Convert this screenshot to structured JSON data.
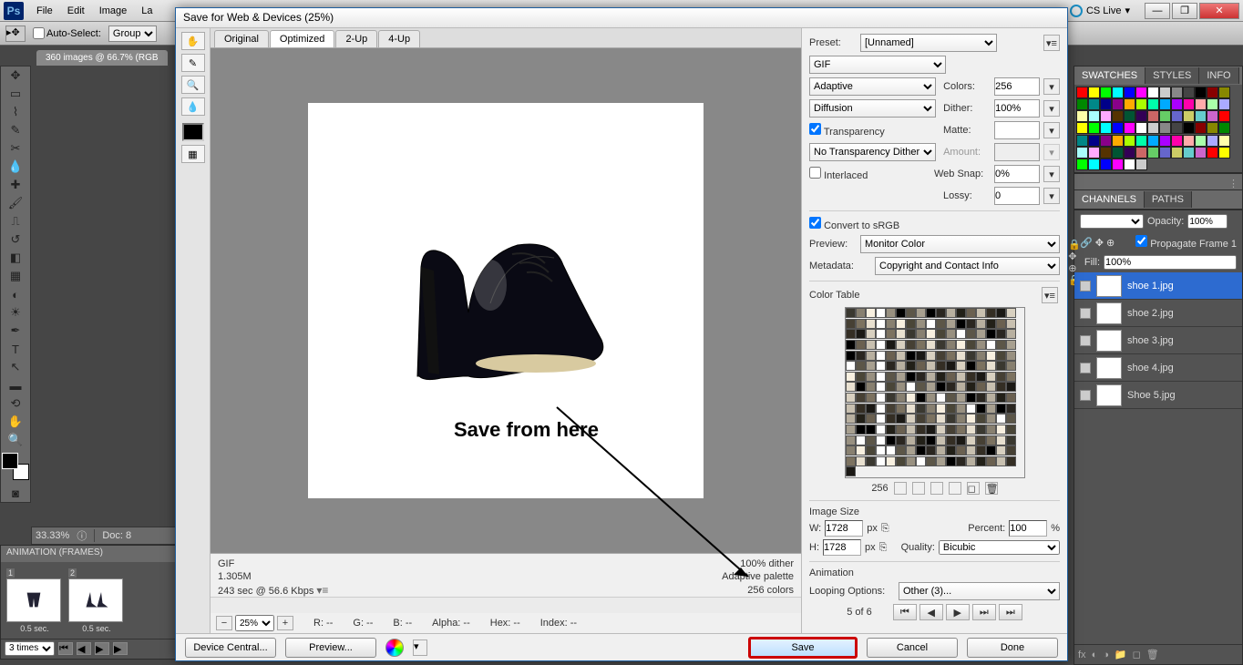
{
  "app": {
    "logo": "Ps",
    "menus": [
      "File",
      "Edit",
      "Image",
      "La"
    ],
    "cslive": "CS Live"
  },
  "optionsbar": {
    "auto_select": "Auto-Select:",
    "group": "Group"
  },
  "doc_tab": "360 images @ 66.7% (RGB",
  "status": {
    "zoom": "33.33%",
    "doc": "Doc: 8"
  },
  "animation_panel": {
    "title": "ANIMATION (FRAMES)",
    "frames": [
      {
        "n": "1",
        "dur": "0.5 sec."
      },
      {
        "n": "2",
        "dur": "0.5 sec."
      }
    ],
    "loop": "3 times"
  },
  "right_panels": {
    "swatches_tab": "SWATCHES",
    "styles_tab": "STYLES",
    "info_tab": "INFO",
    "channels_tab": "CHANNELS",
    "paths_tab": "PATHS",
    "opacity_lbl": "Opacity:",
    "opacity_val": "100%",
    "propagate": "Propagate Frame 1",
    "fill_lbl": "Fill:",
    "fill_val": "100%",
    "layers": [
      {
        "name": "shoe 1.jpg",
        "sel": true
      },
      {
        "name": "shoe 2.jpg"
      },
      {
        "name": "shoe 3.jpg"
      },
      {
        "name": "shoe 4.jpg"
      },
      {
        "name": "Shoe 5.jpg"
      }
    ]
  },
  "dialog": {
    "title": "Save for Web & Devices (25%)",
    "tabs": {
      "original": "Original",
      "optimized": "Optimized",
      "twoup": "2-Up",
      "fourup": "4-Up"
    },
    "annotation": "Save from here",
    "info": {
      "format": "GIF",
      "size": "1.305M",
      "speed": "243 sec @ 56.6 Kbps",
      "dither": "100% dither",
      "palette": "Adaptive palette",
      "colors": "256 colors"
    },
    "zoom": "25%",
    "readout": {
      "r": "R:  --",
      "g": "G:  --",
      "b": "B:  --",
      "alpha": "Alpha:  --",
      "hex": "Hex:  --",
      "index": "Index:  --"
    },
    "preset": {
      "lbl": "Preset:",
      "val": "[Unnamed]"
    },
    "format": "GIF",
    "reduction": "Adaptive",
    "colors_lbl": "Colors:",
    "colors_val": "256",
    "dither_alg": "Diffusion",
    "dither_lbl": "Dither:",
    "dither_val": "100%",
    "transparency": "Transparency",
    "matte_lbl": "Matte:",
    "trans_dither": "No Transparency Dither",
    "amount_lbl": "Amount:",
    "interlaced": "Interlaced",
    "websnap_lbl": "Web Snap:",
    "websnap_val": "0%",
    "lossy_lbl": "Lossy:",
    "lossy_val": "0",
    "srgb": "Convert to sRGB",
    "preview_lbl": "Preview:",
    "preview_val": "Monitor Color",
    "metadata_lbl": "Metadata:",
    "metadata_val": "Copyright and Contact Info",
    "ct_title": "Color Table",
    "ct_count": "256",
    "imgsize_title": "Image Size",
    "w_lbl": "W:",
    "w_val": "1728",
    "h_lbl": "H:",
    "h_val": "1728",
    "px": "px",
    "percent_lbl": "Percent:",
    "percent_val": "100",
    "pct": "%",
    "quality_lbl": "Quality:",
    "quality_val": "Bicubic",
    "anim_title": "Animation",
    "loop_lbl": "Looping Options:",
    "loop_val": "Other (3)...",
    "frame_pos": "5 of 6",
    "btn_device": "Device Central...",
    "btn_preview": "Preview...",
    "btn_save": "Save",
    "btn_cancel": "Cancel",
    "btn_done": "Done"
  }
}
